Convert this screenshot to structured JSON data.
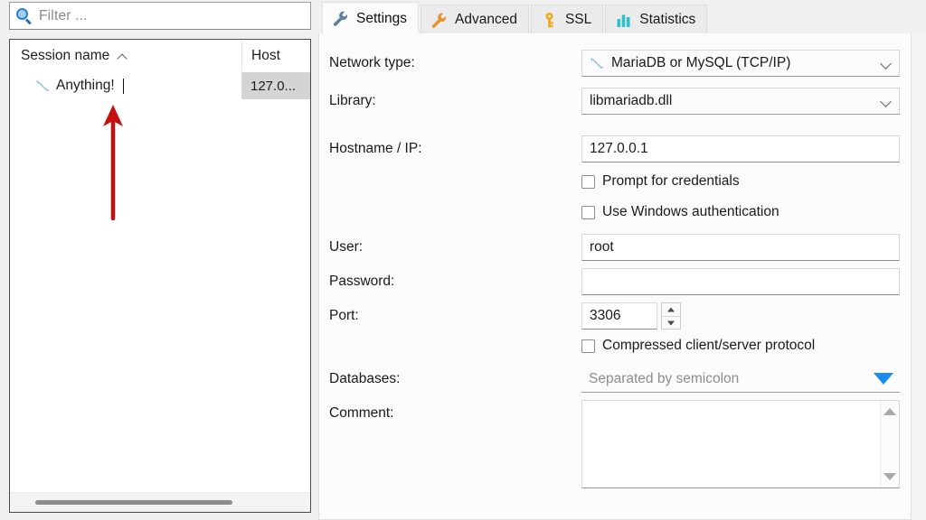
{
  "left": {
    "filter": {
      "placeholder": "Filter ...",
      "icon": "search-icon"
    },
    "tree": {
      "columns": [
        {
          "key": "session_name",
          "label": "Session name",
          "sort": "asc"
        },
        {
          "key": "host",
          "label": "Host"
        }
      ],
      "rows": [
        {
          "icon": "mysql-dolphin-icon",
          "session_name": "Anything!",
          "host": "127.0...",
          "editing": true,
          "host_selected": true
        }
      ]
    },
    "annotation": {
      "type": "arrow",
      "direction": "up",
      "color": "#c61010"
    }
  },
  "right": {
    "tabs": [
      {
        "id": "settings",
        "label": "Settings",
        "icon": "wrench-icon",
        "icon_color": "#5a7fa8",
        "active": true
      },
      {
        "id": "advanced",
        "label": "Advanced",
        "icon": "wrench-icon",
        "icon_color": "#e8922c",
        "active": false
      },
      {
        "id": "ssl",
        "label": "SSL",
        "icon": "key-icon",
        "icon_color": "#f0a81e",
        "active": false
      },
      {
        "id": "statistics",
        "label": "Statistics",
        "icon": "bar-chart-icon",
        "icon_color": "#2fc0d0",
        "active": false
      }
    ],
    "form": {
      "network_type": {
        "label": "Network type:",
        "value": "MariaDB or MySQL (TCP/IP)",
        "icon": "mysql-dolphin-icon"
      },
      "library": {
        "label": "Library:",
        "value": "libmariadb.dll"
      },
      "hostname": {
        "label": "Hostname / IP:",
        "value": "127.0.0.1"
      },
      "prompt_credentials": {
        "label": "Prompt for credentials",
        "checked": false
      },
      "windows_auth": {
        "label": "Use Windows authentication",
        "checked": false
      },
      "user": {
        "label": "User:",
        "value": "root"
      },
      "password": {
        "label": "Password:",
        "value": ""
      },
      "port": {
        "label": "Port:",
        "value": "3306"
      },
      "compressed": {
        "label": "Compressed client/server protocol",
        "checked": false
      },
      "databases": {
        "label": "Databases:",
        "value": "",
        "placeholder": "Separated by semicolon"
      },
      "comment": {
        "label": "Comment:",
        "value": ""
      }
    }
  }
}
